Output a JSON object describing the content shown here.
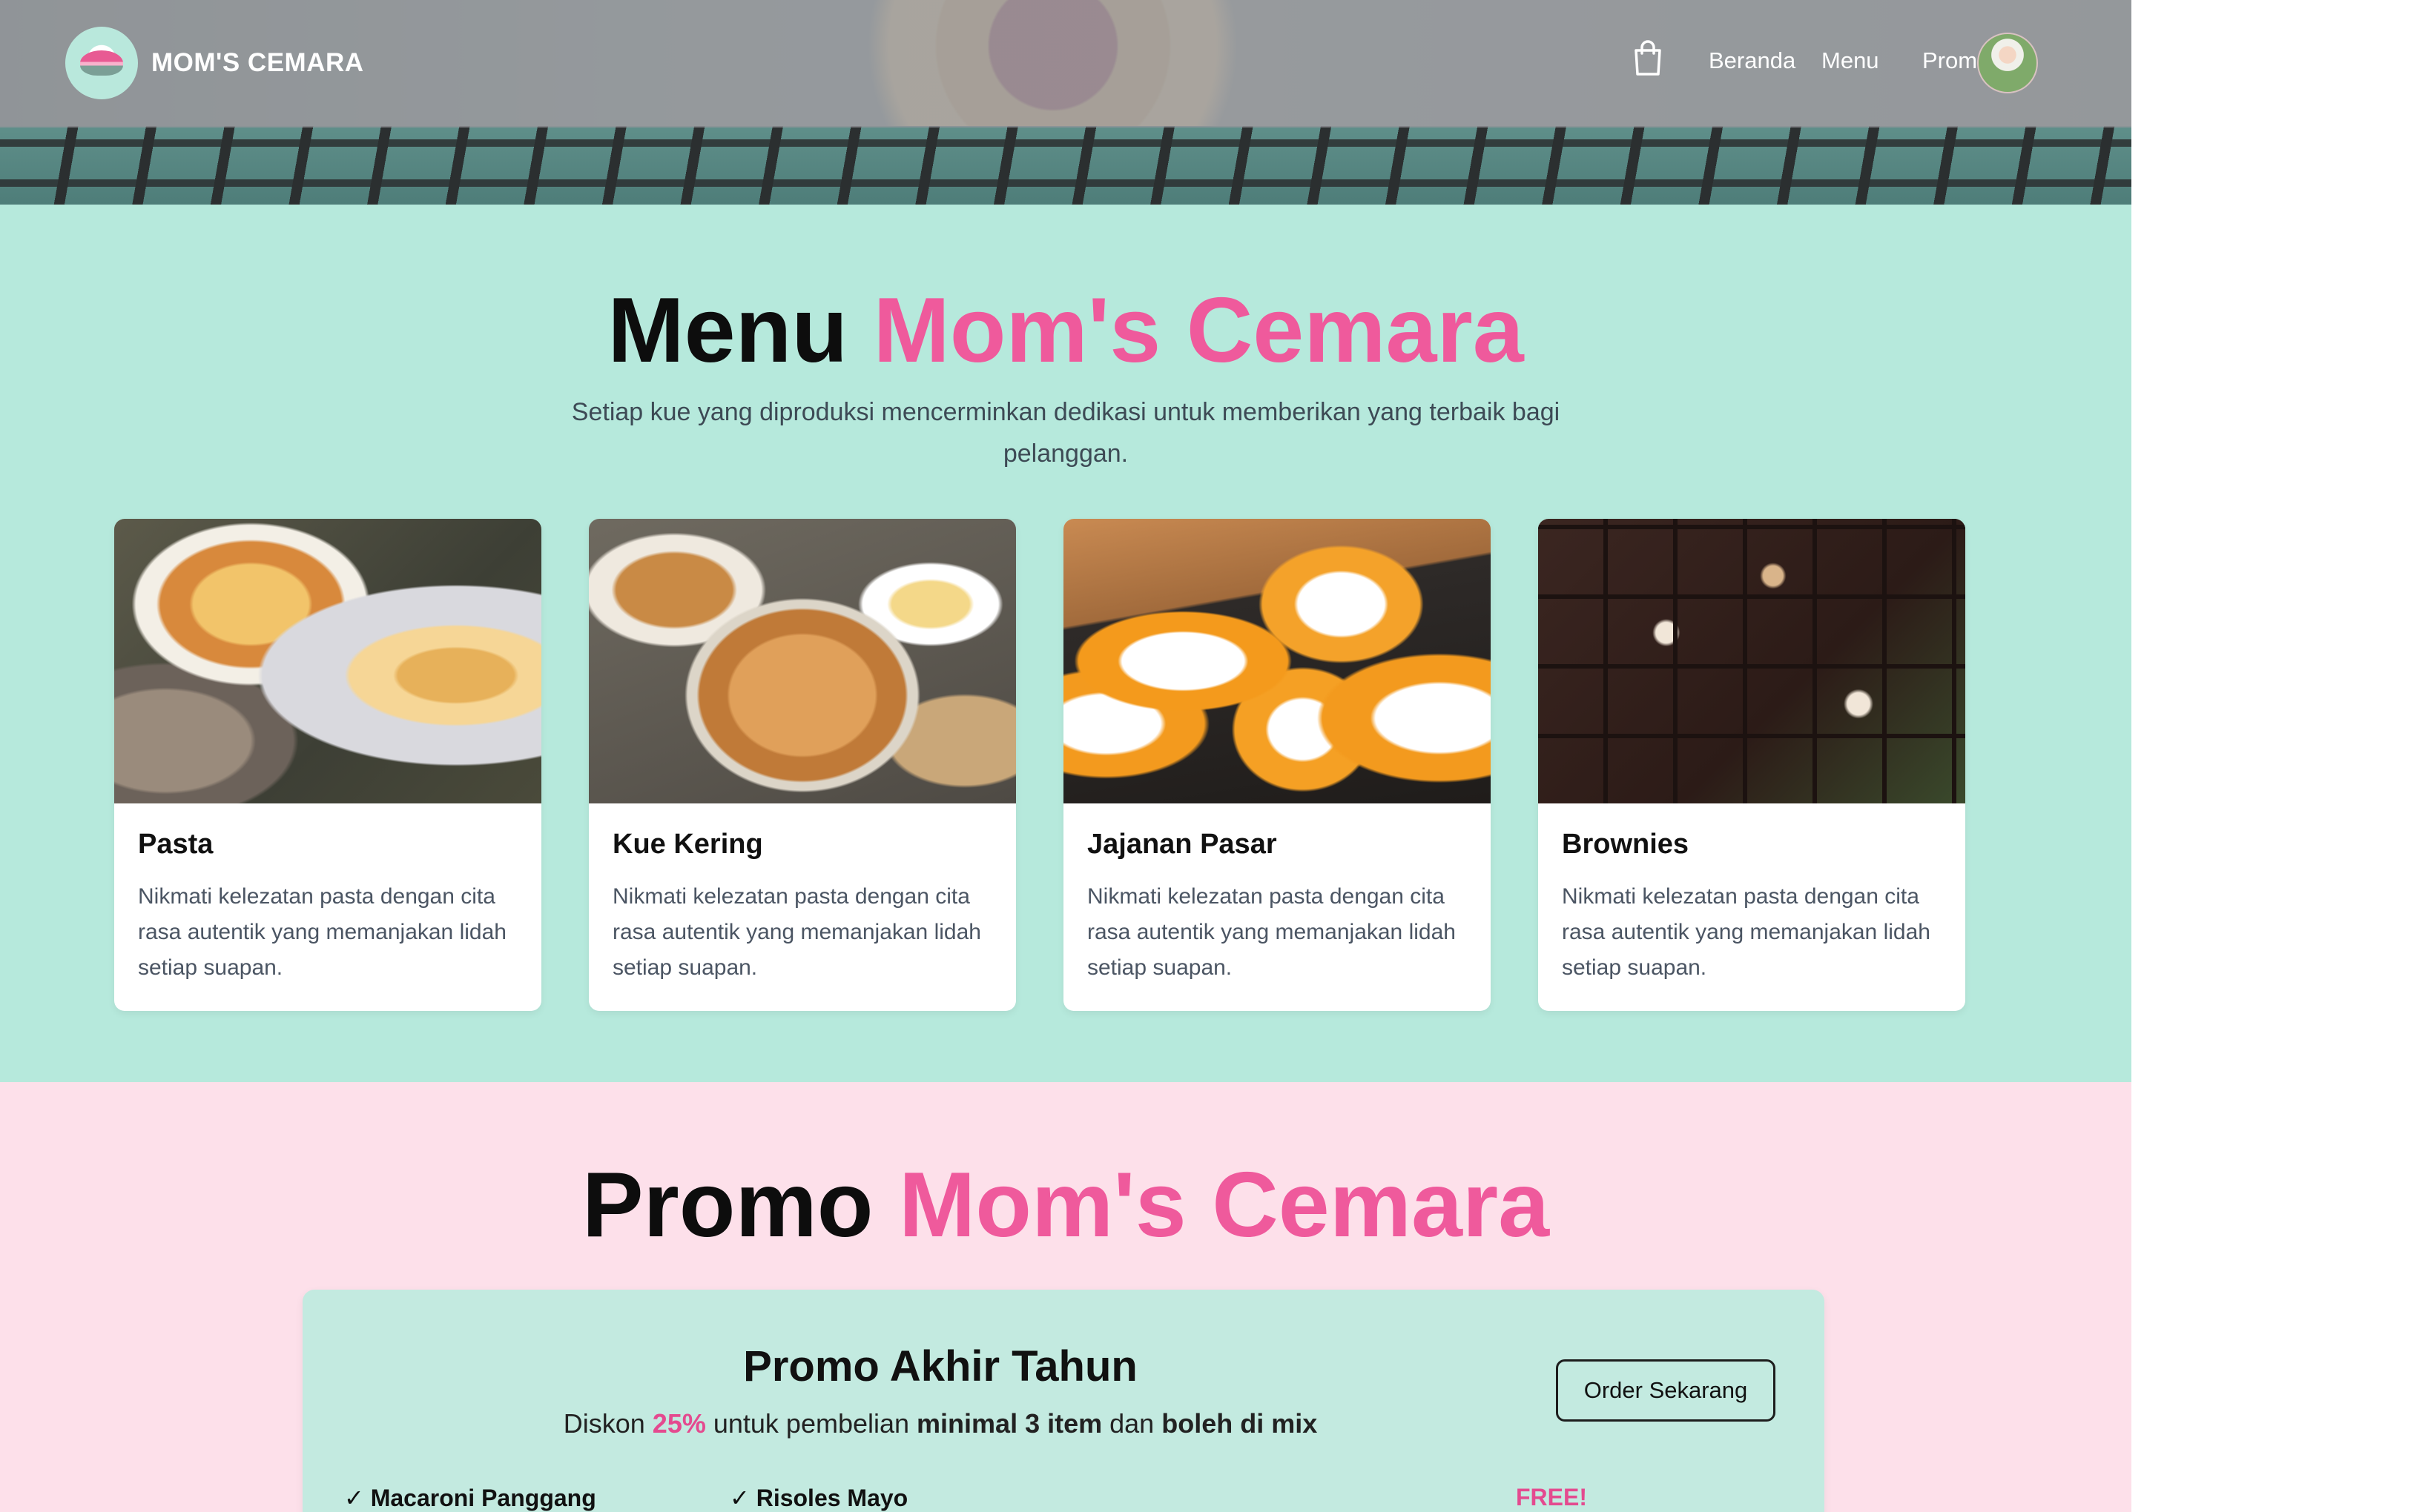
{
  "header": {
    "brand": "MOM'S CEMARA",
    "nav": [
      "Beranda",
      "Menu",
      "Promo"
    ]
  },
  "menu_section": {
    "title_main": "Menu",
    "title_accent": "Mom's Cemara",
    "subtitle": "Setiap kue yang diproduksi mencerminkan dedikasi untuk memberikan yang terbaik bagi pelanggan.",
    "cards": [
      {
        "title": "Pasta",
        "desc": "Nikmati kelezatan pasta dengan cita rasa autentik yang memanjakan lidah setiap suapan."
      },
      {
        "title": "Kue Kering",
        "desc": "Nikmati kelezatan pasta dengan cita rasa autentik yang memanjakan lidah setiap suapan."
      },
      {
        "title": "Jajanan Pasar",
        "desc": "Nikmati kelezatan pasta dengan cita rasa autentik yang memanjakan lidah setiap suapan."
      },
      {
        "title": "Brownies",
        "desc": "Nikmati kelezatan pasta dengan cita rasa autentik yang memanjakan lidah setiap suapan."
      }
    ]
  },
  "promo_section": {
    "title_main": "Promo",
    "title_accent": "Mom's Cemara",
    "promo": {
      "title": "Promo Akhir Tahun",
      "line_prefix": "Diskon ",
      "discount": "25%",
      "line_mid": " untuk pembelian ",
      "min_text": "minimal 3 item",
      "line_and": " dan ",
      "mix_text": "boleh di mix",
      "button": "Order Sekarang",
      "items": [
        "✓ Macaroni Panggang",
        "✓ Risoles Mayo"
      ],
      "free_label": "FREE!"
    }
  },
  "colors": {
    "accent_pink": "#ef5a9c",
    "menu_bg": "#b6e9dc",
    "promo_bg": "#fde0ea",
    "promo_box": "#c3eae0"
  },
  "icons": {
    "cart": "shopping-bag-icon"
  }
}
